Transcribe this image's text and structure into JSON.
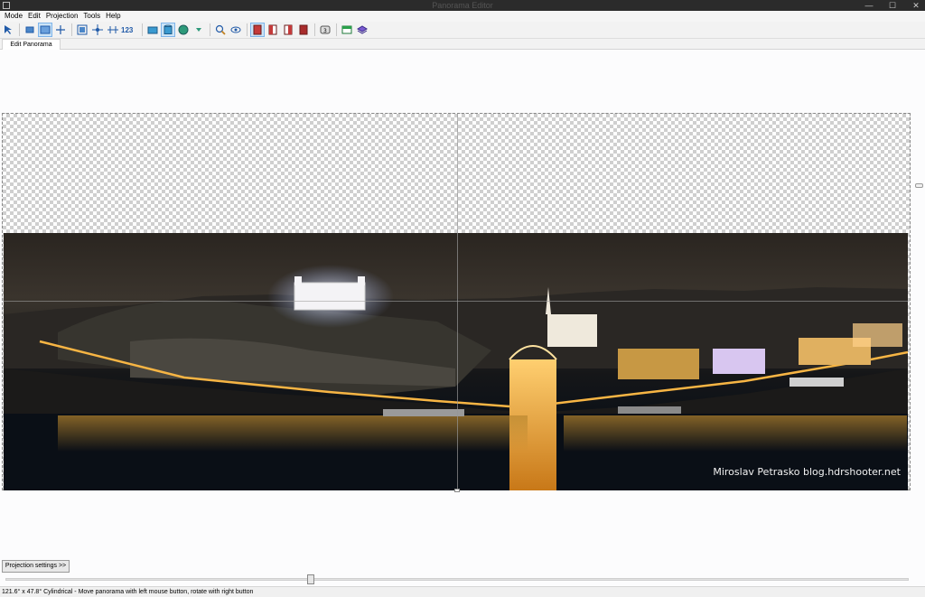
{
  "window": {
    "title": "Panorama Editor",
    "controls": {
      "minimize": "—",
      "maximize": "☐",
      "close": "✕"
    }
  },
  "menu": [
    "Mode",
    "Edit",
    "Projection",
    "Tools",
    "Help"
  ],
  "toolbar": {
    "number_button_label": "123"
  },
  "tabs": [
    "Edit Panorama"
  ],
  "photo": {
    "watermark": "Miroslav  Petrasko  blog.hdrshooter.net"
  },
  "buttons": {
    "projection_settings": "Projection settings >>"
  },
  "slider": {
    "value": 0.338
  },
  "status": {
    "text": "121.6° x 47.8° Cylindrical - Move panorama with left mouse button, rotate with right button"
  },
  "colors": {
    "titlebar": "#2b2b2b",
    "toolbar_accent": "#205aa8",
    "checker_dark": "#cfcfcf"
  }
}
